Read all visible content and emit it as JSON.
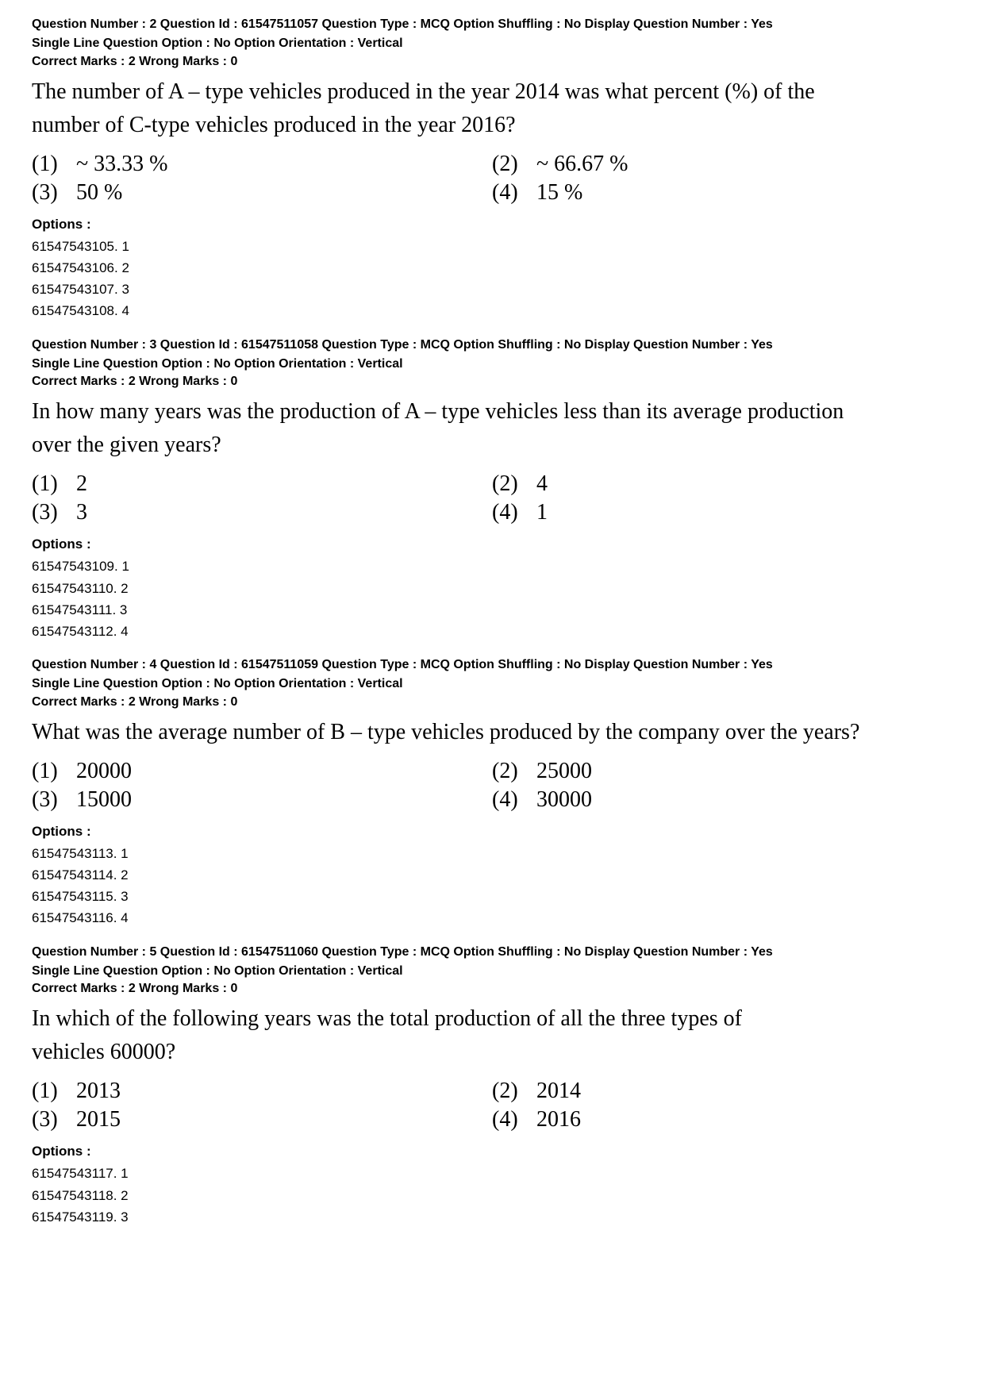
{
  "questions": [
    {
      "id": "q2",
      "meta": "Question Number : 2  Question Id : 61547511057  Question Type : MCQ  Option Shuffling : No  Display Question Number : Yes",
      "meta2": "Single Line Question Option : No  Option Orientation : Vertical",
      "marks": "Correct Marks : 2  Wrong Marks : 0",
      "text_line1": "The number of A – type vehicles produced in the year 2014 was what percent (%) of the",
      "text_line2": "number of C-type vehicles produced in the year 2016?",
      "options": [
        {
          "num": "(1)",
          "val": "~ 33.33 %"
        },
        {
          "num": "(2)",
          "val": "~ 66.67 %"
        },
        {
          "num": "(3)",
          "val": "50 %"
        },
        {
          "num": "(4)",
          "val": "15 %"
        }
      ],
      "options_label": "Options :",
      "codes": [
        "61547543105. 1",
        "61547543106. 2",
        "61547543107. 3",
        "61547543108. 4"
      ]
    },
    {
      "id": "q3",
      "meta": "Question Number : 3  Question Id : 61547511058  Question Type : MCQ  Option Shuffling : No  Display Question Number : Yes",
      "meta2": "Single Line Question Option : No  Option Orientation : Vertical",
      "marks": "Correct Marks : 2  Wrong Marks : 0",
      "text_line1": "In how many years was the production of A – type vehicles less than its average production",
      "text_line2": "over the given years?",
      "options": [
        {
          "num": "(1)",
          "val": "2"
        },
        {
          "num": "(2)",
          "val": "4"
        },
        {
          "num": "(3)",
          "val": "3"
        },
        {
          "num": "(4)",
          "val": "1"
        }
      ],
      "options_label": "Options :",
      "codes": [
        "61547543109. 1",
        "61547543110. 2",
        "61547543111. 3",
        "61547543112. 4"
      ]
    },
    {
      "id": "q4",
      "meta": "Question Number : 4  Question Id : 61547511059  Question Type : MCQ  Option Shuffling : No  Display Question Number : Yes",
      "meta2": "Single Line Question Option : No  Option Orientation : Vertical",
      "marks": "Correct Marks : 2  Wrong Marks : 0",
      "text_line1": "What was the average number of B – type vehicles produced by the company over the years?",
      "text_line2": "",
      "options": [
        {
          "num": "(1)",
          "val": "20000"
        },
        {
          "num": "(2)",
          "val": "25000"
        },
        {
          "num": "(3)",
          "val": "15000"
        },
        {
          "num": "(4)",
          "val": "30000"
        }
      ],
      "options_label": "Options :",
      "codes": [
        "61547543113. 1",
        "61547543114. 2",
        "61547543115. 3",
        "61547543116. 4"
      ]
    },
    {
      "id": "q5",
      "meta": "Question Number : 5  Question Id : 61547511060  Question Type : MCQ  Option Shuffling : No  Display Question Number : Yes",
      "meta2": "Single Line Question Option : No  Option Orientation : Vertical",
      "marks": "Correct Marks : 2  Wrong Marks : 0",
      "text_line1": "In which of the following years was the total production of all the three types of",
      "text_line2": "vehicles 60000?",
      "options": [
        {
          "num": "(1)",
          "val": "2013"
        },
        {
          "num": "(2)",
          "val": "2014"
        },
        {
          "num": "(3)",
          "val": "2015"
        },
        {
          "num": "(4)",
          "val": "2016"
        }
      ],
      "options_label": "Options :",
      "codes": [
        "61547543117. 1",
        "61547543118. 2",
        "61547543119. 3"
      ]
    }
  ]
}
